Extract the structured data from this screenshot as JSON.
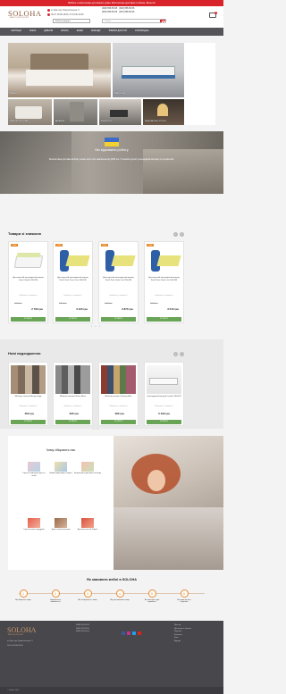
{
  "topbar": "Мебель и аксессуары для вашего дома. Бесплатная доставка по Киеву. Звоните!",
  "header": {
    "logo": "SOLOHA",
    "logo_sub": "МЕБЛІ ДЛЯ ДОМУ",
    "info1": "м. Київ, вул. Бориспільська, 9",
    "info2": "Пн-Пт 09:00-18:00, Сб 10:00-16:00",
    "phones": [
      "(098) 555-55-55",
      "(050) 555-55-55"
    ],
    "phones2": [
      "(063) 555-55-55",
      "(067) 555-55-55"
    ],
    "cabinet": "Кабінет покупця",
    "search_placeholder": "Пошук...",
    "cart_count": "0"
  },
  "nav": [
    "МАТРАЦИ",
    "ЛІЖКА",
    "ДИВАНИ",
    "КРІСЛА",
    "ШАФИ",
    "КОМОДИ",
    "ТОВАРИ ДЛЯ СНУ",
    "РОЗПРОДАЖ"
  ],
  "categories": [
    "Ліжка",
    "Матраци",
    "Крісла та пуфи",
    "Дивани",
    "Текстиль",
    "Журнальні столи",
    "Аксесуари"
  ],
  "promo": {
    "title": "Ми відновили роботу",
    "desc": "Безкоштовна доставка меблів у межах міста при замовленні від 3000 грн. Уточнюйте деталі у менеджерів магазину за телефоном."
  },
  "winter": {
    "title": "Товари зі знижкою",
    "products": [
      {
        "badge": "-10%",
        "name": "Двосторонній ортопедичний матрац Latex Comfort 160x200",
        "avail": "Наявність: в наявності",
        "old": "3 100 грн",
        "price": "2 790 грн",
        "buy": "КУПИТИ"
      },
      {
        "badge": "-10%",
        "name": "Двосторонній ортопедичний матрац Fresh Zone Cocos Line 160x200",
        "avail": "Наявність: в наявності",
        "old": "3 800 грн",
        "price": "3 420 грн",
        "buy": "КУПИТИ"
      },
      {
        "badge": "-10%",
        "name": "Двосторонній ортопедичний матрац Fresh Zone Latex Line 160x200",
        "avail": "Наявність: в наявності",
        "old": "4 300 грн",
        "price": "3 870 грн",
        "buy": "КУПИТИ"
      },
      {
        "badge": "-10%",
        "name": "Двосторонній ортопедичний матрац Fresh Zone Latex Line 140x200",
        "avail": "Наявність: в наявності",
        "old": "3 900 грн",
        "price": "3 510 грн",
        "buy": "КУПИТИ"
      }
    ]
  },
  "new": {
    "title": "Нові надходження",
    "products": [
      {
        "name": "Меблева тканина Велюр Тедді",
        "avail": "Наявність: в наявності",
        "price": "360 грн",
        "buy": "КУПИТИ"
      },
      {
        "name": "Меблева тканина Шеніл Моно",
        "avail": "Наявність: в наявності",
        "price": "290 грн",
        "buy": "КУПИТИ"
      },
      {
        "name": "Меблева тканина Рогожка Мікс",
        "avail": "Наявність: в наявності",
        "price": "280 грн",
        "buy": "КУПИТИ"
      },
      {
        "name": "Ортопедичний матрац Сплайн 160x200",
        "avail": "Наявність: в наявності",
        "price": "5 490 грн",
        "buy": "КУПИТИ"
      }
    ]
  },
  "why": {
    "title": "Чому обирають нас",
    "items": [
      "Гарантія найнижчої ціни на меблі",
      "Найбільший вибір в Україні",
      "Безкоштовна доставка по Києву",
      "Гарантія якості продукції",
      "Зручні способи оплати",
      "Доставка по всій Україні"
    ]
  },
  "steps": {
    "title": "Як замовити меблі в SOLOHA",
    "items": [
      {
        "num": "1",
        "text": "Ви обираєте товар"
      },
      {
        "num": "2",
        "text": "Оформлюєте замовлення"
      },
      {
        "num": "3",
        "text": "Ми зв'язуємося з вами"
      },
      {
        "num": "4",
        "text": "Ми доставляємо товар"
      },
      {
        "num": "5",
        "text": "Ви оплачуєте при отриманні"
      },
      {
        "num": "6",
        "text": "Ви користуєтесь покупкою"
      }
    ]
  },
  "footer": {
    "logo": "SOLOHA",
    "logo_sub": "МЕБЛІ ДЛЯ ДОМУ",
    "address": "м. Київ, вул. Бориспільська, 9",
    "hours": "Пн-Пт 09:00-18:00",
    "phones": [
      "(098) 555-55-55",
      "(050) 555-55-55",
      "(063) 555-55-55"
    ],
    "links": [
      "Про нас",
      "Доставка та оплата",
      "Гарантія",
      "Контакти",
      "Блог",
      "Відгуки"
    ],
    "copyright": "© Soloha 2020"
  }
}
